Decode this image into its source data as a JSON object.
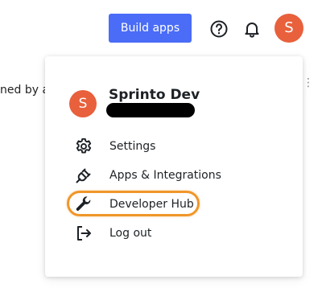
{
  "topbar": {
    "build_apps_label": "Build apps",
    "help_icon": "question-circle-icon",
    "notifications_icon": "bell-icon",
    "avatar_initial": "S"
  },
  "background": {
    "partial_text": "ned by an",
    "more_icon": "vertical-ellipsis-icon"
  },
  "dropdown": {
    "user": {
      "avatar_initial": "S",
      "name": "Sprinto Dev"
    },
    "items": [
      {
        "label": "Settings",
        "icon": "gear-icon"
      },
      {
        "label": "Apps & Integrations",
        "icon": "plug-icon"
      },
      {
        "label": "Developer Hub",
        "icon": "wrench-icon"
      },
      {
        "label": "Log out",
        "icon": "logout-icon"
      }
    ]
  },
  "colors": {
    "accent": "#4a6cf7",
    "avatar": "#e8603c",
    "highlight": "#f0962a"
  }
}
